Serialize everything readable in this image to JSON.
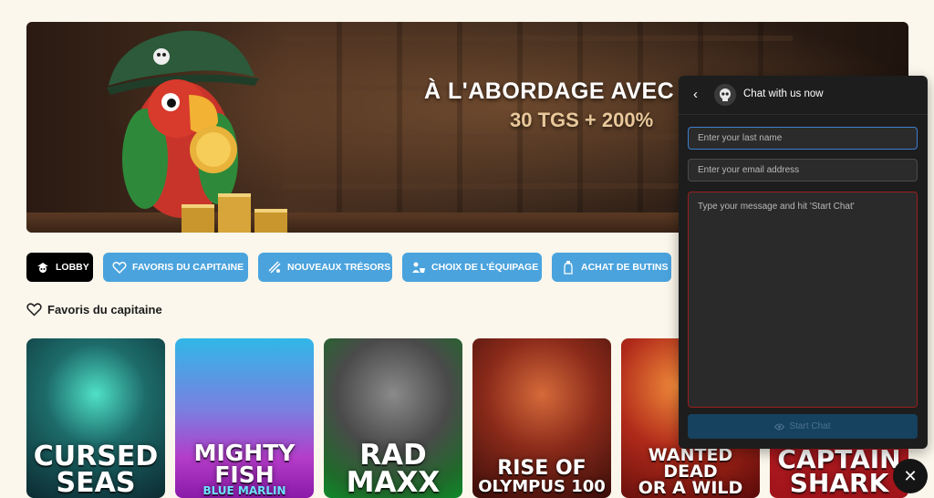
{
  "banner": {
    "title": "À L'ABORDAGE AVEC",
    "subtitle": "30 TGS + 200%"
  },
  "categories": [
    {
      "label": "LOBBY",
      "icon": "skull-icon"
    },
    {
      "label": "FAVORIS DU CAPITAINE",
      "icon": "heart-icon"
    },
    {
      "label": "NOUVEAUX TRÉSORS",
      "icon": "new-treasure-icon"
    },
    {
      "label": "CHOIX DE L'ÉQUIPAGE",
      "icon": "crew-icon"
    },
    {
      "label": "ACHAT DE BUTINS",
      "icon": "bottle-icon"
    }
  ],
  "section": {
    "title": "Favoris du capitaine",
    "icon": "heart-outline-icon"
  },
  "games": [
    {
      "line1": "CURSED",
      "line2": "SEAS",
      "line3": ""
    },
    {
      "line1": "MIGHTY",
      "line2": "FISH",
      "line3": "BLUE MARLIN"
    },
    {
      "line1": "RAD",
      "line2": "MAXX",
      "line3": ""
    },
    {
      "line1": "RISE OF",
      "line2": "OLYMPUS 100",
      "line3": ""
    },
    {
      "line1": "WANTED",
      "line2": "DEAD",
      "line3": "OR A WILD"
    },
    {
      "line1": "CAPTAIN",
      "line2": "SHARK",
      "line3": ""
    }
  ],
  "chat": {
    "title": "Chat with us now",
    "last_name_placeholder": "Enter your last name",
    "email_placeholder": "Enter your email address",
    "message_placeholder": "Type your message and hit 'Start Chat'",
    "start_label": "Start Chat"
  },
  "colors": {
    "page_bg": "#fbf7ec",
    "pill_blue": "#4aa3dd",
    "pill_active": "#000000",
    "chat_bg": "#1d1d1d"
  }
}
